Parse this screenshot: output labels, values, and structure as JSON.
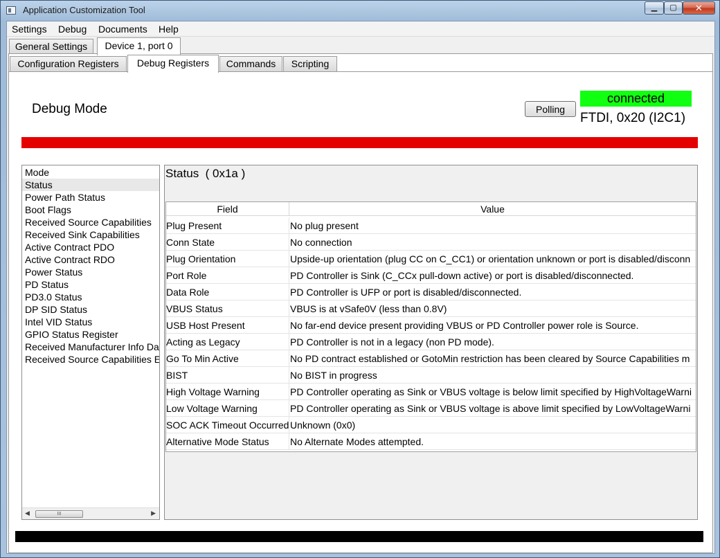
{
  "window": {
    "title": "Application Customization Tool",
    "buttons": {
      "minimize": "▁",
      "maximize": "▢",
      "close": "✕"
    }
  },
  "menu": [
    "Settings",
    "Debug",
    "Documents",
    "Help"
  ],
  "top_tabs": [
    {
      "label": "General Settings",
      "active": false
    },
    {
      "label": "Device 1, port 0",
      "active": true
    }
  ],
  "sub_tabs": [
    {
      "label": "Configuration Registers",
      "active": false
    },
    {
      "label": "Debug Registers",
      "active": true
    },
    {
      "label": "Commands",
      "active": false
    },
    {
      "label": "Scripting",
      "active": false
    }
  ],
  "header": {
    "mode_label": "Debug Mode",
    "polling_label": "Polling",
    "connection_status": "connected",
    "connection_info": "FTDI, 0x20 (I2C1)",
    "status_color": "#11ff11",
    "alert_bar_color": "#e50000"
  },
  "register_list": {
    "items": [
      "Mode",
      "Status",
      "Power Path Status",
      "Boot Flags",
      "Received Source Capabilities",
      "Received Sink Capabilities",
      "Active Contract PDO",
      "Active Contract RDO",
      "Power Status",
      "PD Status",
      "PD3.0 Status",
      "DP SID Status",
      "Intel VID Status",
      "GPIO Status Register",
      "Received Manufacturer Info Da",
      "Received Source Capabilities E"
    ],
    "selected_index": 1,
    "scroll_thumb_label": "III"
  },
  "register_detail": {
    "title": "Status  ( 0x1a )",
    "columns": [
      "Field",
      "Value"
    ],
    "rows": [
      {
        "field": "Plug Present",
        "value": "No plug present"
      },
      {
        "field": "Conn State",
        "value": "No connection"
      },
      {
        "field": "Plug Orientation",
        "value": "Upside-up orientation (plug CC on C_CC1) or orientation unknown or port is disabled/disconn"
      },
      {
        "field": "Port Role",
        "value": "PD Controller is Sink (C_CCx pull-down active) or port is disabled/disconnected."
      },
      {
        "field": "Data Role",
        "value": "PD Controller is UFP or port is disabled/disconnected."
      },
      {
        "field": "VBUS Status",
        "value": "VBUS is at vSafe0V (less than 0.8V)"
      },
      {
        "field": "USB Host Present",
        "value": "No far-end device present providing VBUS or PD Controller power role is Source."
      },
      {
        "field": "Acting as Legacy",
        "value": "PD Controller is not in a legacy (non PD mode)."
      },
      {
        "field": "Go To Min Active",
        "value": "No PD contract established or GotoMin restriction has been cleared by Source Capabilities m"
      },
      {
        "field": "BIST",
        "value": "No BIST in progress"
      },
      {
        "field": "High Voltage Warning",
        "value": "PD Controller operating as Sink or VBUS voltage is below limit specified by HighVoltageWarni"
      },
      {
        "field": "Low Voltage Warning",
        "value": "PD Controller operating as Sink or VBUS voltage is above limit specified by LowVoltageWarni"
      },
      {
        "field": "SOC ACK Timeout Occurred",
        "value": "Unknown (0x0)"
      },
      {
        "field": "Alternative Mode Status",
        "value": "No Alternate Modes attempted."
      }
    ]
  }
}
